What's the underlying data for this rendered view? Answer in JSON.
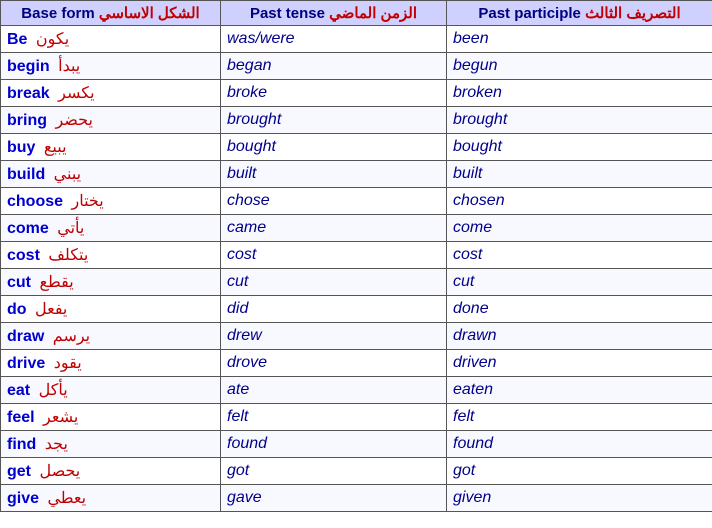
{
  "table": {
    "headers": [
      {
        "en": "Base form",
        "ar": "الشكل الاساسي"
      },
      {
        "en": "Past tense",
        "ar": "الزمن الماضي"
      },
      {
        "en": "Past participle",
        "ar": "التصريف الثالث"
      }
    ],
    "rows": [
      {
        "base_en": "Be",
        "base_ar": "يكون",
        "past": "was/were",
        "pp": "been"
      },
      {
        "base_en": "begin",
        "base_ar": "يبدأ",
        "past": "began",
        "pp": "begun"
      },
      {
        "base_en": "break",
        "base_ar": "يكسر",
        "past": "broke",
        "pp": "broken"
      },
      {
        "base_en": "bring",
        "base_ar": "يحضر",
        "past": "brought",
        "pp": "brought"
      },
      {
        "base_en": "buy",
        "base_ar": "يبيع",
        "past": "bought",
        "pp": "bought"
      },
      {
        "base_en": "build",
        "base_ar": "يبني",
        "past": "built",
        "pp": "built"
      },
      {
        "base_en": "choose",
        "base_ar": "يختار",
        "past": "chose",
        "pp": "chosen"
      },
      {
        "base_en": "come",
        "base_ar": "يأتي",
        "past": "came",
        "pp": "come"
      },
      {
        "base_en": "cost",
        "base_ar": "يتكلف",
        "past": "cost",
        "pp": "cost"
      },
      {
        "base_en": "cut",
        "base_ar": "يقطع",
        "past": "cut",
        "pp": "cut"
      },
      {
        "base_en": "do",
        "base_ar": "يفعل",
        "past": "did",
        "pp": "done"
      },
      {
        "base_en": "draw",
        "base_ar": "يرسم",
        "past": "drew",
        "pp": "drawn"
      },
      {
        "base_en": "drive",
        "base_ar": "يقود",
        "past": "drove",
        "pp": "driven"
      },
      {
        "base_en": "eat",
        "base_ar": "يأكل",
        "past": "ate",
        "pp": "eaten"
      },
      {
        "base_en": "feel",
        "base_ar": "يشعر",
        "past": "felt",
        "pp": "felt"
      },
      {
        "base_en": "find",
        "base_ar": "يجد",
        "past": "found",
        "pp": "found"
      },
      {
        "base_en": "get",
        "base_ar": "يحصل",
        "past": "got",
        "pp": "got"
      },
      {
        "base_en": "give",
        "base_ar": "يعطي",
        "past": "gave",
        "pp": "given"
      }
    ]
  }
}
